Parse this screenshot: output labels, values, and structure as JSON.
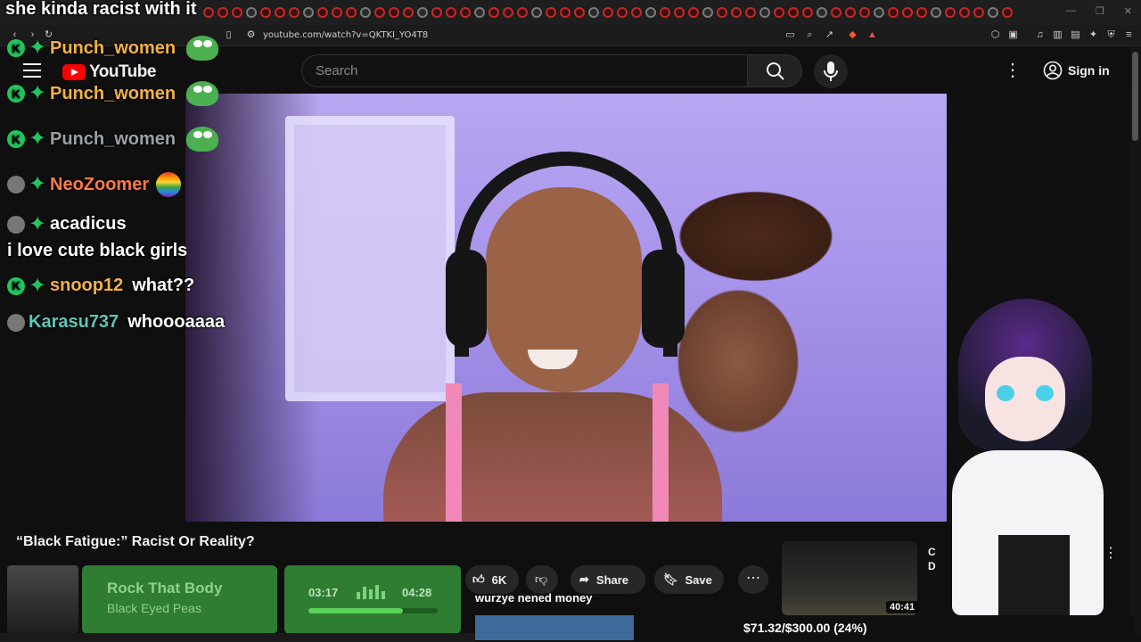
{
  "stream_title": "she kinda racist with it",
  "browser": {
    "url": "youtube.com/watch?v=QKTKI_YO4T8",
    "tab_count": 57
  },
  "youtube": {
    "logo_text": "YouTube",
    "search_placeholder": "Search",
    "sign_in_label": "Sign in",
    "video_title": "“Black Fatigue:” Racist Or Reality?",
    "like_count": "6K",
    "share_label": "Share",
    "save_label": "Save",
    "related_video": {
      "title": "C\nD",
      "duration": "40:41"
    }
  },
  "chat": [
    {
      "user": "Punch_women",
      "color": "#f5b342",
      "message": "",
      "badges": [
        "k",
        "plus"
      ],
      "emote": "pepe"
    },
    {
      "user": "Punch_women",
      "color": "#f5b342",
      "message": "",
      "badges": [
        "k",
        "plus"
      ],
      "emote": "pepe"
    },
    {
      "user": "Punch_women",
      "color": "#9aa0a6",
      "message": "",
      "badges": [
        "k",
        "plus"
      ],
      "emote": "pepe"
    },
    {
      "user": "NeoZoomer",
      "color": "#ff7a45",
      "message": "",
      "badges": [
        "avatar",
        "plus"
      ],
      "emote": "pride"
    },
    {
      "user": "acadicus",
      "color": "#ffffff",
      "message": "i love cute black girls",
      "badges": [
        "avatar",
        "plus"
      ],
      "emote": ""
    },
    {
      "user": "snoop12",
      "color": "#f5b342",
      "message": "what??",
      "badges": [
        "k",
        "plus"
      ],
      "emote": ""
    },
    {
      "user": "Karasu737",
      "color": "#5ec8b8",
      "message": "whoooaaaa",
      "badges": [
        "avatar"
      ],
      "emote": ""
    }
  ],
  "now_playing": {
    "title": "Rock That Body",
    "artist": "Black Eyed Peas",
    "elapsed": "03:17",
    "total": "04:28",
    "progress_fraction": 0.73
  },
  "chat_caption": "wurzye nened money",
  "donation_goal": {
    "text": "$71.32/$300.00 (24%)",
    "fraction": 0.24
  },
  "colors": {
    "accent_red": "#ff0000",
    "overlay_green": "#2e7d32",
    "donation_blue": "#3d6a9a"
  }
}
